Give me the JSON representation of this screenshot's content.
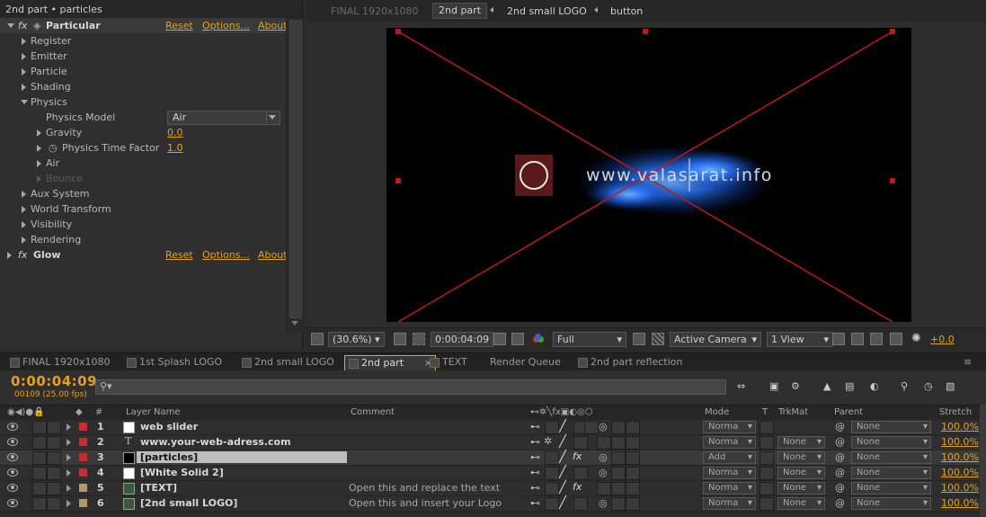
{
  "effect_panel": {
    "title": "2nd part • particles",
    "effects": [
      {
        "name": "Particular",
        "reset": "Reset",
        "options": "Options...",
        "about": "About"
      },
      {
        "name": "Glow",
        "reset": "Reset",
        "options": "Options...",
        "about": "About"
      }
    ],
    "groups": [
      "Register",
      "Emitter",
      "Particle",
      "Shading",
      "Physics"
    ],
    "physics": {
      "model_label": "Physics Model",
      "model_value": "Air",
      "gravity_label": "Gravity",
      "gravity_value": "0.0",
      "time_factor_label": "Physics Time Factor",
      "time_factor_value": "1.0",
      "air_label": "Air",
      "bounce_label": "Bounce"
    },
    "groups_after": [
      "Aux System",
      "World Transform",
      "Visibility",
      "Rendering"
    ]
  },
  "viewer": {
    "tabs": [
      "FINAL 1920x1080",
      "2nd part",
      "2nd small LOGO",
      "button"
    ],
    "canvas_text": "www.valasarat.info",
    "toolbar": {
      "zoom": "(30.6%)",
      "timecode": "0:00:04:09",
      "resolution": "Full",
      "camera": "Active Camera",
      "view": "1 View",
      "exposure": "+0.0"
    }
  },
  "timeline": {
    "tabs": [
      "FINAL 1920x1080",
      "1st Splash LOGO",
      "2nd small LOGO",
      "2nd part",
      "TEXT",
      "Render Queue",
      "2nd part reflection"
    ],
    "active_tab": "2nd part",
    "timecode": "0:00:04:09",
    "frames": "00109 (25.00 fps)",
    "search_placeholder": "",
    "columns": {
      "number": "#",
      "layer_name": "Layer Name",
      "comment": "Comment",
      "mode": "Mode",
      "t": "T",
      "trkmat": "TrkMat",
      "parent": "Parent",
      "stretch": "Stretch"
    },
    "layers": [
      {
        "num": "1",
        "name": "web slider",
        "comment": "",
        "mode": "Norma",
        "trkmat": "",
        "parent": "None",
        "stretch": "100.0%",
        "label_color": "#c03030",
        "type": "solid-white"
      },
      {
        "num": "2",
        "name": "www.your-web-adress.com",
        "comment": "",
        "mode": "Norma",
        "trkmat": "None",
        "parent": "None",
        "stretch": "100.0%",
        "label_color": "#c03030",
        "type": "text"
      },
      {
        "num": "3",
        "name": "[particles]",
        "comment": "",
        "mode": "Add",
        "trkmat": "None",
        "parent": "None",
        "stretch": "100.0%",
        "label_color": "#c03030",
        "type": "solid-black"
      },
      {
        "num": "4",
        "name": "[White Solid 2]",
        "comment": "",
        "mode": "Norma",
        "trkmat": "None",
        "parent": "None",
        "stretch": "100.0%",
        "label_color": "#c03030",
        "type": "solid-white"
      },
      {
        "num": "5",
        "name": "[TEXT]",
        "comment": "Open this and replace the text",
        "mode": "Norma",
        "trkmat": "None",
        "parent": "None",
        "stretch": "100.0%",
        "label_color": "#b09870",
        "type": "comp"
      },
      {
        "num": "6",
        "name": "[2nd small LOGO]",
        "comment": "Open this and insert your Logo",
        "mode": "Norma",
        "trkmat": "None",
        "parent": "None",
        "stretch": "100.0%",
        "label_color": "#b09870",
        "type": "comp"
      }
    ]
  },
  "colors": {
    "accent": "#e4a020",
    "guide_lines": "#c01818",
    "particles": "#2a78ff"
  }
}
